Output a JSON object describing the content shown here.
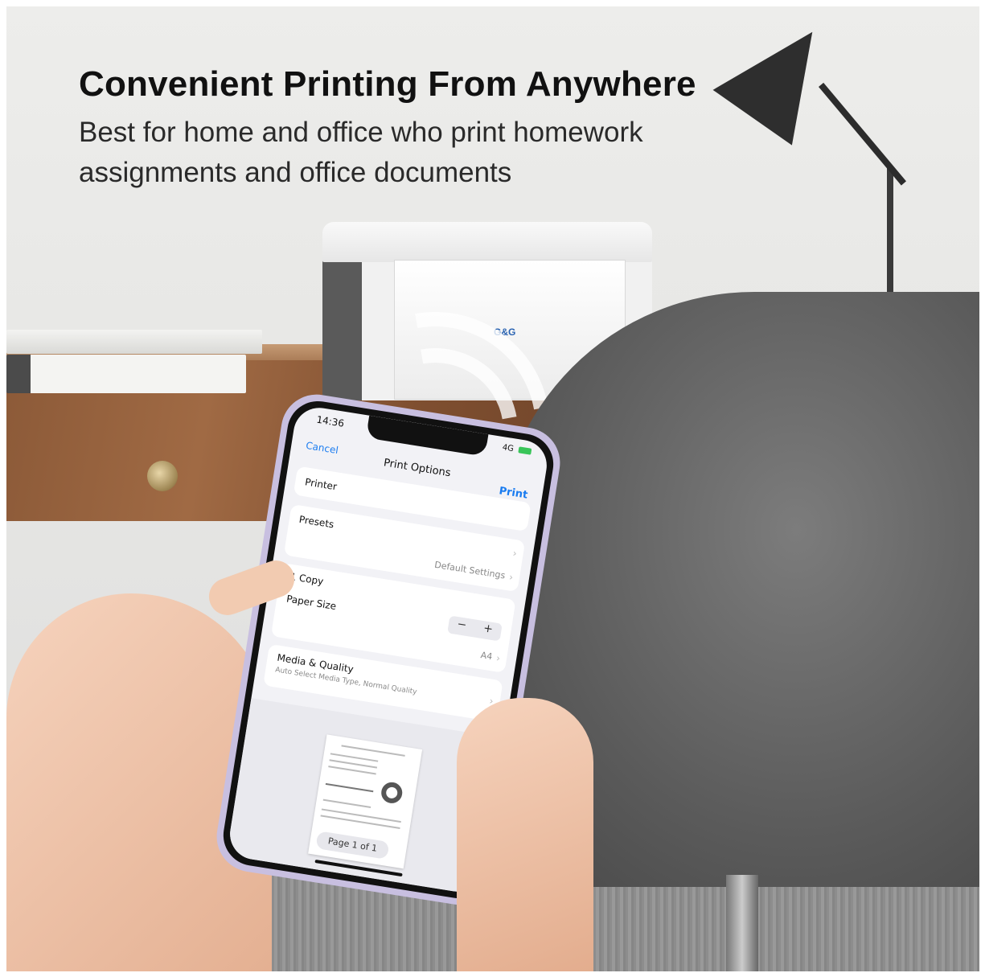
{
  "headline": {
    "title": "Convenient Printing From Anywhere",
    "subtitle": "Best for home and office who print homework assignments and office documents"
  },
  "printer": {
    "brand": "G&G"
  },
  "phone": {
    "status_time": "14:36",
    "status_network": "4G",
    "nav": {
      "cancel": "Cancel",
      "title": "Print Options",
      "print": "Print"
    },
    "rows": {
      "printer_label": "Printer",
      "presets_label": "Presets",
      "presets_value": "Default Settings",
      "copies_label": "1 Copy",
      "paper_size_label": "Paper Size",
      "paper_size_value": "A4",
      "media_label": "Media & Quality",
      "media_sub": "Auto Select Media Type, Normal Quality"
    },
    "stepper": {
      "minus": "−",
      "plus": "+"
    },
    "preview": {
      "page_indicator": "Page 1 of 1"
    }
  }
}
